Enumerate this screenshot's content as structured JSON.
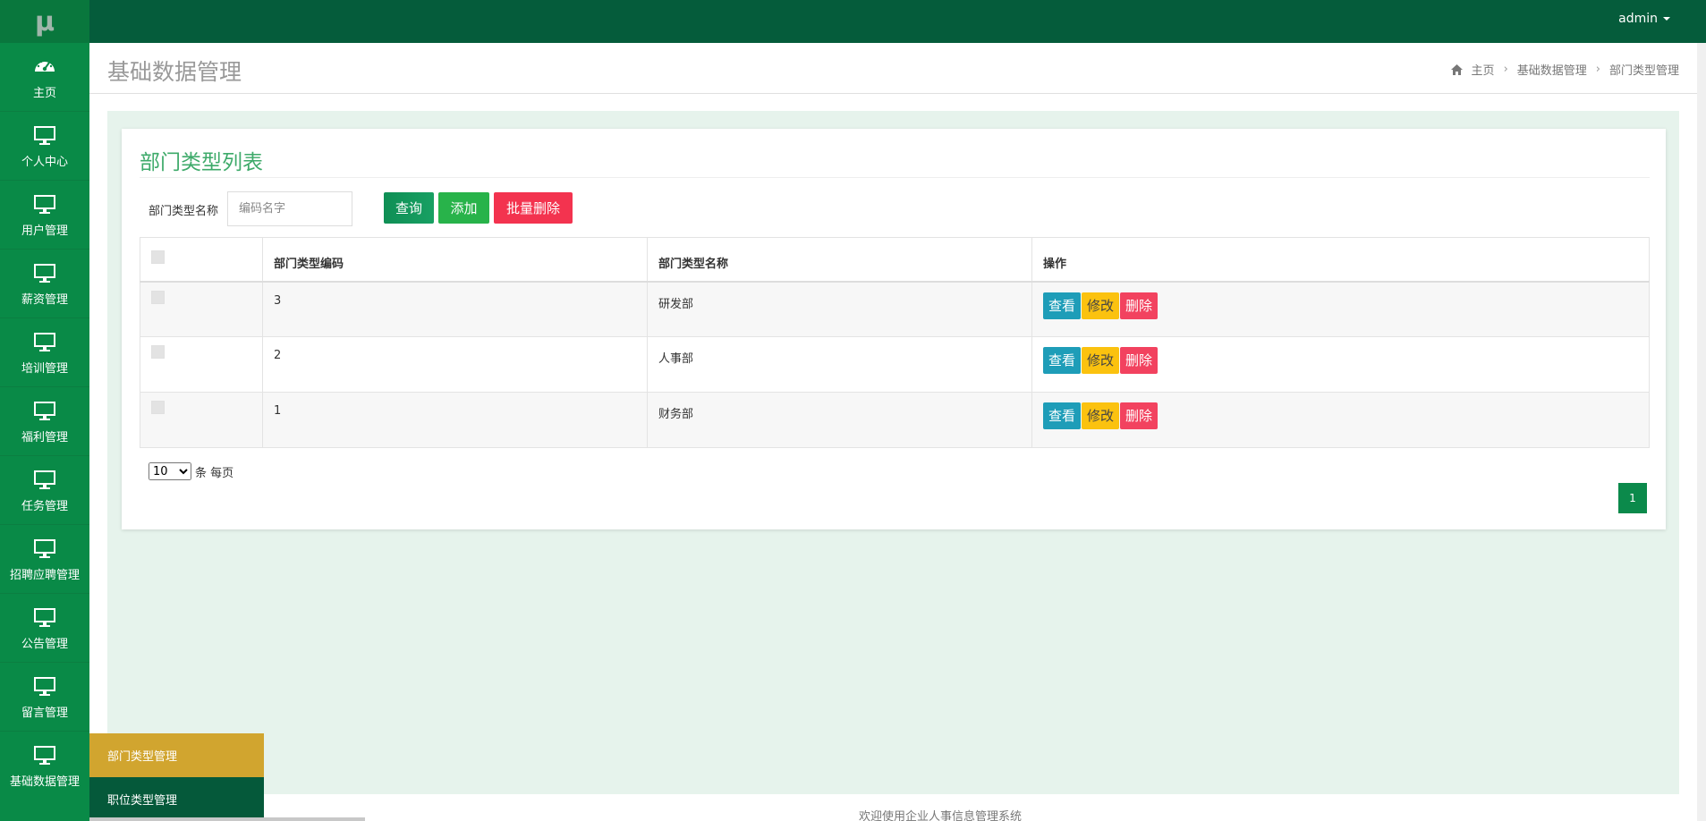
{
  "app": {
    "logo": "μ"
  },
  "sidebar": {
    "items": [
      {
        "label": "主页",
        "icon": "dashboard-icon"
      },
      {
        "label": "个人中心",
        "icon": "monitor-icon"
      },
      {
        "label": "用户管理",
        "icon": "monitor-icon"
      },
      {
        "label": "薪资管理",
        "icon": "monitor-icon"
      },
      {
        "label": "培训管理",
        "icon": "monitor-icon"
      },
      {
        "label": "福利管理",
        "icon": "monitor-icon"
      },
      {
        "label": "任务管理",
        "icon": "monitor-icon"
      },
      {
        "label": "招聘应聘管理",
        "icon": "monitor-icon"
      },
      {
        "label": "公告管理",
        "icon": "monitor-icon"
      },
      {
        "label": "留言管理",
        "icon": "monitor-icon"
      },
      {
        "label": "基础数据管理",
        "icon": "monitor-icon"
      }
    ],
    "submenu": [
      {
        "label": "部门类型管理",
        "active": true
      },
      {
        "label": "职位类型管理",
        "active": false
      }
    ]
  },
  "topbar": {
    "user": "admin"
  },
  "header": {
    "title": "基础数据管理",
    "breadcrumb": [
      "主页",
      "基础数据管理",
      "部门类型管理"
    ]
  },
  "card": {
    "title": "部门类型列表",
    "search_label": "部门类型名称",
    "search_placeholder": "编码名字",
    "query_label": "查询",
    "add_label": "添加",
    "batch_delete_label": "批量删除"
  },
  "table": {
    "headers": [
      "部门类型编码",
      "部门类型名称",
      "操作"
    ],
    "rows": [
      {
        "code": "3",
        "name": "研发部"
      },
      {
        "code": "2",
        "name": "人事部"
      },
      {
        "code": "1",
        "name": "财务部"
      }
    ],
    "actions": {
      "view": "查看",
      "edit": "修改",
      "delete": "删除"
    }
  },
  "pagination": {
    "page_size": "10",
    "per_page_text": "条 每页",
    "current_page": "1"
  },
  "footer": {
    "text": "欢迎使用企业人事信息管理系统"
  },
  "colors": {
    "sidebar": "#098a47",
    "topbar": "#055c3b",
    "accent_title": "#3eaa6a",
    "content_bg": "#e6f3ec",
    "submenu_active": "#d1a52f"
  }
}
